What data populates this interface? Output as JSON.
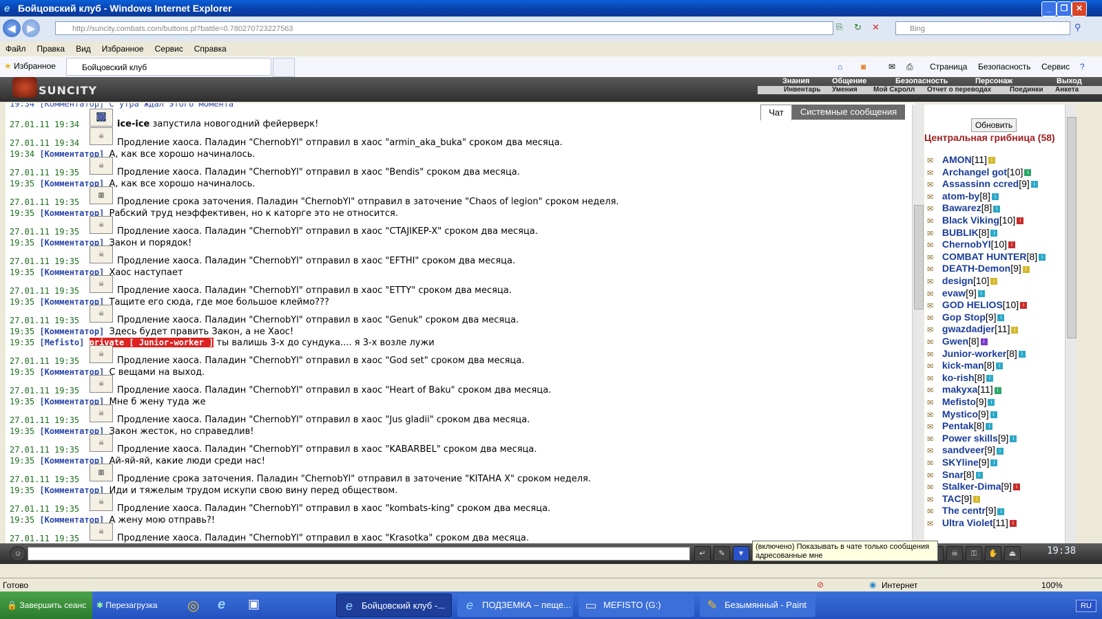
{
  "window": {
    "title": "Бойцовский клуб - Windows Internet Explorer",
    "controls": [
      "_",
      "❐",
      "✕"
    ]
  },
  "address": {
    "url": "http://suncity.combats.com/buttons.pl?battle=0.780270723227563",
    "search_placeholder": "Bing"
  },
  "menu": [
    "Файл",
    "Правка",
    "Вид",
    "Избранное",
    "Сервис",
    "Справка"
  ],
  "favorites": {
    "label": "Избранное",
    "tab_title": "Бойцовский клуб",
    "commands": [
      "Страница",
      "Безопасность",
      "Сервис"
    ]
  },
  "game": {
    "logo": "SUNCITY",
    "nav_top": [
      "Знания",
      "Общение",
      "Безопасность",
      "Персонаж",
      "Выход"
    ],
    "nav_bottom": [
      "Инвентарь",
      "Умения",
      "Мой Скролл",
      "Отчет о переводах",
      "Поединки",
      "Анкета"
    ]
  },
  "chat": {
    "tabs": [
      "Чат",
      "Системные сообщения"
    ],
    "partial_top": "19:34 [Комментатор] С утра ждал этого момента",
    "messages": [
      {
        "ts": "27.01.11 19:34",
        "avatar": "🎆",
        "text_name": "ice-ice",
        "text": " запустила новогодний фейерверк!"
      },
      {
        "ts": "27.01.11 19:34",
        "avatar": "☠",
        "text": "Продление хаоса. Паладин \"ChernobYl\" отправил в хаос \"armin_aka_buka\" сроком два месяца.",
        "com_ts": "19:34",
        "com_label": "[Комментатор]",
        "com": "А, как все хорошо начиналось."
      },
      {
        "ts": "27.01.11 19:35",
        "avatar": "☠",
        "text": "Продление хаоса. Паладин \"ChernobYl\" отправил в хаос \"Bendis\" сроком два месяца.",
        "com_ts": "19:35",
        "com_label": "[Комментатор]",
        "com": "А, как все хорошо начиналось."
      },
      {
        "ts": "27.01.11 19:35",
        "avatar": "▥",
        "text": "Продление срока заточения. Паладин \"ChernobYl\" отправил в заточение \"Chaos of legion\" сроком неделя.",
        "com_ts": "19:35",
        "com_label": "[Комментатор]",
        "com": "Рабский труд неэффективен, но к каторге это не относится."
      },
      {
        "ts": "27.01.11 19:35",
        "avatar": "☠",
        "text": "Продление хаоса. Паладин \"ChernobYl\" отправил в хаос \"CTAJIKEP-X\" сроком два месяца.",
        "com_ts": "19:35",
        "com_label": "[Комментатор]",
        "com": "Закон и порядок!"
      },
      {
        "ts": "27.01.11 19:35",
        "avatar": "☠",
        "text": "Продление хаоса. Паладин \"ChernobYl\" отправил в хаос \"EFTHI\" сроком два месяца.",
        "com_ts": "19:35",
        "com_label": "[Комментатор]",
        "com": "Хаос наступает"
      },
      {
        "ts": "27.01.11 19:35",
        "avatar": "☠",
        "text": "Продление хаоса. Паладин \"ChernobYl\" отправил в хаос \"ETTY\" сроком два месяца.",
        "com_ts": "19:35",
        "com_label": "[Комментатор]",
        "com": "Тащите его сюда, где мое большое клеймо???"
      },
      {
        "ts": "27.01.11 19:35",
        "avatar": "☠",
        "text": "Продление хаоса. Паладин \"ChernobYl\" отправил в хаос \"Genuk\" сроком два месяца.",
        "com_ts": "19:35",
        "com_label": "[Комментатор]",
        "com": "Здесь будет править Закон, а не Хаос!",
        "private_ts": "19:35",
        "private_from": "[Mefisto]",
        "private_tag": "private [ Junior-worker ]",
        "private_text": " ты валишь 3-х до сундука.... я 3-х возле лужи"
      },
      {
        "ts": "27.01.11 19:35",
        "avatar": "☠",
        "text": "Продление хаоса. Паладин \"ChernobYl\" отправил в хаос \"God set\" сроком два месяца.",
        "com_ts": "19:35",
        "com_label": "[Комментатор]",
        "com": "С вещами на выход."
      },
      {
        "ts": "27.01.11 19:35",
        "avatar": "☠",
        "text": "Продление хаоса. Паладин \"ChernobYl\" отправил в хаос \"Heart of Baku\" сроком два месяца.",
        "com_ts": "19:35",
        "com_label": "[Комментатор]",
        "com": "Мне б жену туда же"
      },
      {
        "ts": "27.01.11 19:35",
        "avatar": "☠",
        "text": "Продление хаоса. Паладин \"ChernobYl\" отправил в хаос \"Jus gladii\" сроком два месяца.",
        "com_ts": "19:35",
        "com_label": "[Комментатор]",
        "com": "Закон жесток, но справедлив!"
      },
      {
        "ts": "27.01.11 19:35",
        "avatar": "☠",
        "text": "Продление хаоса. Паладин \"ChernobYl\" отправил в хаос \"KABARBEL\" сроком два месяца.",
        "com_ts": "19:35",
        "com_label": "[Комментатор]",
        "com": "Ай-яй-яй, какие люди среди нас!"
      },
      {
        "ts": "27.01.11 19:35",
        "avatar": "▥",
        "text": "Продление срока заточения. Паладин \"ChernobYl\" отправил в заточение \"KITAHA X\" сроком неделя.",
        "com_ts": "19:35",
        "com_label": "[Комментатор]",
        "com": "Иди и тяжелым трудом искупи свою вину перед обществом."
      },
      {
        "ts": "27.01.11 19:35",
        "avatar": "☠",
        "text": "Продление хаоса. Паладин \"ChernobYl\" отправил в хаос \"kombats-king\" сроком два месяца.",
        "com_ts": "19:35",
        "com_label": "[Комментатор]",
        "com": "А жену мою отправь?!"
      },
      {
        "ts": "27.01.11 19:35",
        "avatar": "☠",
        "text": "Продление хаоса. Паладин \"ChernobYl\" отправил в хаос \"Krasotka\" сроком два месяца."
      }
    ]
  },
  "room": {
    "refresh_label": "Обновить",
    "name": "Центральная грибница (58)",
    "users": [
      {
        "name": "AMON",
        "level": "[11]",
        "info_color": "#d4b82a"
      },
      {
        "name": "Archangel got",
        "level": "[10]",
        "info_color": "#2aa86a"
      },
      {
        "name": "Assassinn ccred",
        "level": "[9]",
        "info_color": "#2aa8c8"
      },
      {
        "name": "atom-by",
        "level": "[8]",
        "info_color": "#2aa8c8"
      },
      {
        "name": "Bawarez",
        "level": "[8]",
        "info_color": "#2aa8c8"
      },
      {
        "name": "Black Viking",
        "level": "[10]",
        "info_color": "#c82a2a"
      },
      {
        "name": "BUBLIK",
        "level": "[8]",
        "info_color": "#2aa8c8"
      },
      {
        "name": "ChernobYl",
        "level": "[10]",
        "info_color": "#c82a2a"
      },
      {
        "name": "COMBAT HUNTER",
        "level": "[8]",
        "info_color": "#2aa8c8"
      },
      {
        "name": "DEATH-Demon",
        "level": "[9]",
        "info_color": "#d4b82a"
      },
      {
        "name": "design",
        "level": "[10]",
        "info_color": "#d4b82a"
      },
      {
        "name": "evaw",
        "level": "[9]",
        "info_color": "#2aa8c8"
      },
      {
        "name": "GOD HELIOS",
        "level": "[10]",
        "info_color": "#c82a2a"
      },
      {
        "name": "Gop Stop",
        "level": "[9]",
        "info_color": "#2aa8c8"
      },
      {
        "name": "gwazdadjer",
        "level": "[11]",
        "info_color": "#d4b82a"
      },
      {
        "name": "Gwen",
        "level": "[8]",
        "info_color": "#7a3ac8"
      },
      {
        "name": "Junior-worker",
        "level": "[8]",
        "info_color": "#2aa8c8"
      },
      {
        "name": "kick-man",
        "level": "[8]",
        "info_color": "#2aa8c8"
      },
      {
        "name": "ko-rish",
        "level": "[8]",
        "info_color": "#2aa8c8"
      },
      {
        "name": "makyxa",
        "level": "[11]",
        "info_color": "#2aa86a"
      },
      {
        "name": "Mefisto",
        "level": "[9]",
        "info_color": "#2aa8c8"
      },
      {
        "name": "Mystico",
        "level": "[9]",
        "info_color": "#2aa8c8"
      },
      {
        "name": "Pentak",
        "level": "[8]",
        "info_color": "#2aa8c8"
      },
      {
        "name": "Power skills",
        "level": "[9]",
        "info_color": "#2aa8c8"
      },
      {
        "name": "sandveer",
        "level": "[9]",
        "info_color": "#2aa8c8"
      },
      {
        "name": "SKYline",
        "level": "[9]",
        "info_color": "#2aa8c8"
      },
      {
        "name": "Snar",
        "level": "[8]",
        "info_color": "#2aa8c8"
      },
      {
        "name": "Stalker-Dima",
        "level": "[9]",
        "info_color": "#c82a2a"
      },
      {
        "name": "TAC",
        "level": "[9]",
        "info_color": "#d4b82a"
      },
      {
        "name": "The centr",
        "level": "[9]",
        "info_color": "#2aa8c8"
      },
      {
        "name": "Ultra Violet",
        "level": "[11]",
        "info_color": "#c82a2a"
      }
    ]
  },
  "toolbar": {
    "tooltip": "(включено) Показывать в чате только сообщения адресованные мне",
    "clock": "19:38"
  },
  "status": {
    "left": "Готово",
    "zone": "Интернет",
    "zoom": "100%"
  },
  "taskbar": {
    "start_items": [
      "Завершить сеанс",
      "Перезагрузка"
    ],
    "tasks": [
      "Бойцовский клуб -...",
      "ПОДЗЕМКА – пеще...",
      "MEFISTO (G:)",
      "Безымянный - Paint"
    ],
    "lang": "RU"
  }
}
